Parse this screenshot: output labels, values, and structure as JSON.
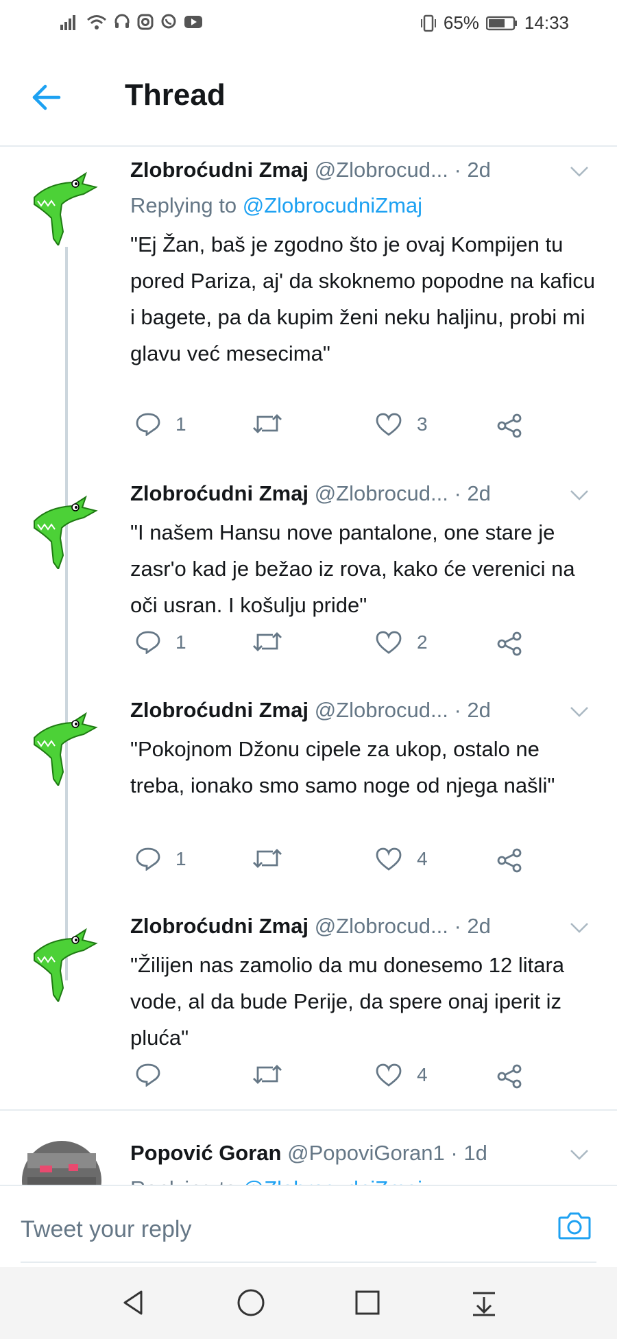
{
  "status_bar": {
    "battery": "65%",
    "time": "14:33"
  },
  "header": {
    "title": "Thread"
  },
  "tweets": [
    {
      "name": "Zlobroćudni Zmaj",
      "handle": "@Zlobrocud...",
      "time": "· 2d",
      "replying_label": "Replying to ",
      "replying_handle": "@ZlobrocudniZmaj",
      "text": "\"Ej Žan, baš je zgodno što je ovaj Kompijen tu pored Pariza, aj' da skoknemo popodne na kaficu i bagete, pa da kupim ženi neku haljinu, probi mi glavu već mesecima\"",
      "replies": "1",
      "retweets": "",
      "likes": "3"
    },
    {
      "name": "Zlobroćudni Zmaj",
      "handle": "@Zlobrocud...",
      "time": "· 2d",
      "text": "\"I našem Hansu nove pantalone, one stare je zasr'o kad je bežao iz rova, kako će verenici na oči usran. I košulju pride\"",
      "replies": "1",
      "retweets": "",
      "likes": "2"
    },
    {
      "name": "Zlobroćudni Zmaj",
      "handle": "@Zlobrocud...",
      "time": "· 2d",
      "text": "\"Pokojnom Džonu cipele za ukop, ostalo ne treba, ionako smo samo noge od njega našli\"",
      "replies": "1",
      "retweets": "",
      "likes": "4"
    },
    {
      "name": "Zlobroćudni Zmaj",
      "handle": "@Zlobrocud...",
      "time": "· 2d",
      "text": "\"Žilijen nas zamolio da mu donesemo 12 litara vode, al da bude Perije, da spere onaj iperit iz pluća\"",
      "replies": "",
      "retweets": "",
      "likes": "4"
    },
    {
      "name": "Popović Goran",
      "handle": "@PopoviGoran1",
      "time": "· 1d",
      "replying_label": "Replying to ",
      "replying_handle": "@ZlobrocudniZmaj"
    }
  ],
  "reply_bar": {
    "placeholder": "Tweet your reply"
  },
  "colors": {
    "accent": "#1da1f2",
    "muted": "#657786",
    "divider": "#e6ecf0",
    "avatar_green": "#4cd137"
  }
}
